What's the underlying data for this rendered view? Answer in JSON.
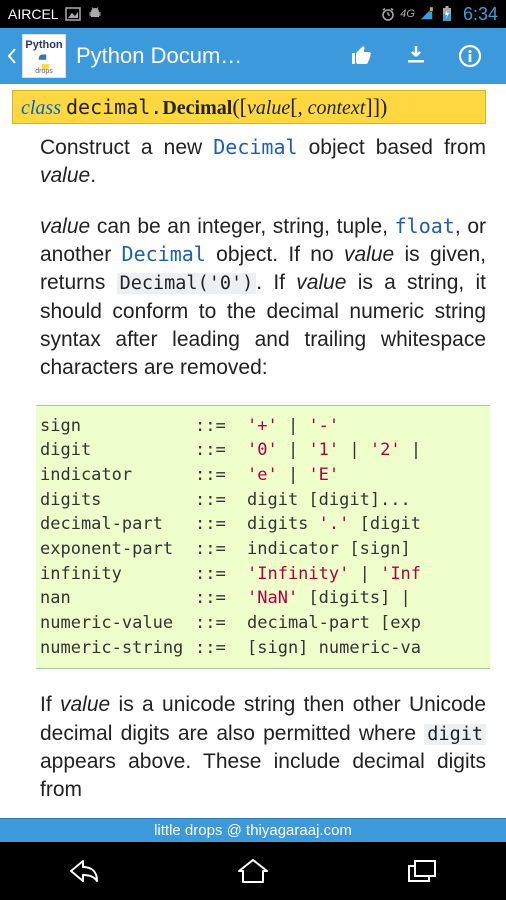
{
  "status": {
    "carrier": "AIRCEL",
    "time": "6:34",
    "net": "4G"
  },
  "appbar": {
    "title": "Python Docum…",
    "app_icon_label": "Python",
    "app_icon_sub": "drops"
  },
  "signature": {
    "kw": "class",
    "module": "decimal.",
    "classname": "Decimal",
    "open": "(",
    "opt_open": "[",
    "arg1": "value",
    "opt2_open": "[",
    "arg2_sep": ", ",
    "arg2": "context",
    "opt2_close": "]",
    "opt_close": "]",
    "close": ")"
  },
  "body": {
    "p1_a": "Construct a new ",
    "p1_link": "Decimal",
    "p1_b": " object based from ",
    "p1_value": "value",
    "p1_c": ".",
    "p2_value1": "value",
    "p2_a": " can be an integer, string, tuple, ",
    "p2_float": "float",
    "p2_b": ", or another ",
    "p2_decimal": "Decimal",
    "p2_c": " object. If no ",
    "p2_value2": "value",
    "p2_d": " is given, returns ",
    "p2_code": "Decimal('0')",
    "p2_e": ". If ",
    "p2_value3": "value",
    "p2_f": " is a string, it should conform to the decimal numeric string syntax after leading and trailing whitespace characters are removed:",
    "p3_a": "If ",
    "p3_value": "value",
    "p3_b": " is a unicode string then other Unicode decimal digits are also permitted where ",
    "p3_digit": "digit",
    "p3_c": " appears above. These include decimal digits from"
  },
  "grammar": [
    {
      "name": "sign",
      "def_parts": [
        " ",
        {
          "lit": "'+'"
        },
        " | ",
        {
          "lit": "'-'"
        }
      ]
    },
    {
      "name": "digit",
      "def_parts": [
        " ",
        {
          "lit": "'0'"
        },
        " | ",
        {
          "lit": "'1'"
        },
        " | ",
        {
          "lit": "'2'"
        },
        " |"
      ]
    },
    {
      "name": "indicator",
      "def_parts": [
        " ",
        {
          "lit": "'e'"
        },
        " | ",
        {
          "lit": "'E'"
        }
      ]
    },
    {
      "name": "digits",
      "def_parts": [
        " digit [digit]..."
      ]
    },
    {
      "name": "decimal-part",
      "def_parts": [
        " digits ",
        {
          "lit": "'.'"
        },
        " [digit"
      ]
    },
    {
      "name": "exponent-part",
      "def_parts": [
        " indicator [sign] "
      ]
    },
    {
      "name": "infinity",
      "def_parts": [
        " ",
        {
          "lit": "'Infinity'"
        },
        " | ",
        {
          "lit": "'Inf"
        }
      ]
    },
    {
      "name": "nan",
      "def_parts": [
        " ",
        {
          "lit": "'NaN'"
        },
        " [digits] |"
      ]
    },
    {
      "name": "numeric-value",
      "def_parts": [
        " decimal-part [exp"
      ]
    },
    {
      "name": "numeric-string",
      "def_parts": [
        " [sign] numeric-va"
      ]
    }
  ],
  "footer": {
    "text": "little drops @ thiyagaraaj.com"
  }
}
